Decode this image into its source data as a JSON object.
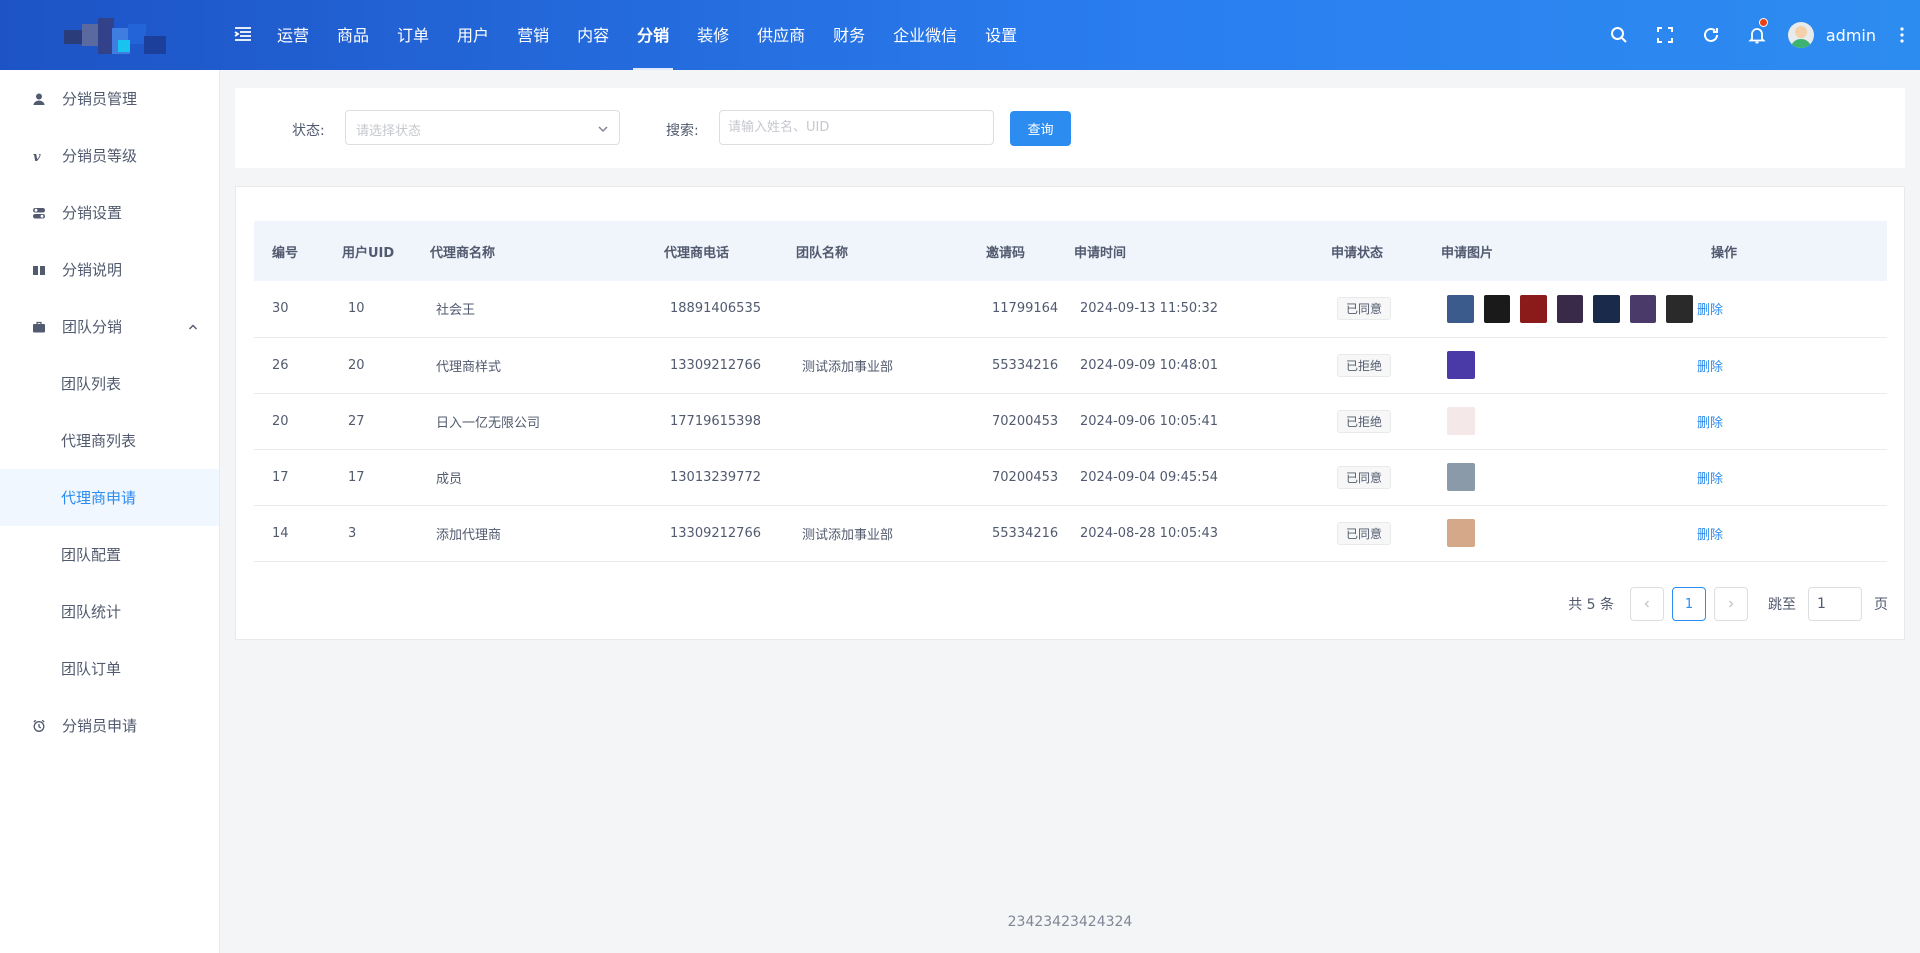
{
  "header": {
    "nav": [
      "运营",
      "商品",
      "订单",
      "用户",
      "营销",
      "内容",
      "分销",
      "装修",
      "供应商",
      "财务",
      "企业微信",
      "设置"
    ],
    "active_nav": "分销",
    "username": "admin"
  },
  "sidebar": {
    "items": [
      {
        "label": "分销员管理",
        "icon": "user-icon"
      },
      {
        "label": "分销员等级",
        "icon": "vimeo-icon"
      },
      {
        "label": "分销设置",
        "icon": "toggle-icon"
      },
      {
        "label": "分销说明",
        "icon": "book-icon"
      },
      {
        "label": "团队分销",
        "icon": "briefcase-icon"
      },
      {
        "label": "团队列表"
      },
      {
        "label": "代理商列表"
      },
      {
        "label": "代理商申请"
      },
      {
        "label": "团队配置"
      },
      {
        "label": "团队统计"
      },
      {
        "label": "团队订单"
      },
      {
        "label": "分销员申请",
        "icon": "alarm-clock-icon"
      }
    ],
    "active": "代理商申请"
  },
  "filter": {
    "status_label": "状态:",
    "status_placeholder": "请选择状态",
    "search_label": "搜索:",
    "search_placeholder": "请输入姓名、UID",
    "query_button": "查询"
  },
  "table": {
    "columns": [
      "编号",
      "用户UID",
      "代理商名称",
      "代理商电话",
      "团队名称",
      "邀请码",
      "申请时间",
      "申请状态",
      "申请图片",
      "操作"
    ],
    "rows": [
      {
        "id": "30",
        "uid": "10",
        "name": "社会王",
        "phone": "18891406535",
        "team": "",
        "code": "11799164",
        "time": "2024-09-13 11:50:32",
        "status": "已同意",
        "images": [
          "#3b5b8c",
          "#1a1a1a",
          "#8b1a1a",
          "#3a2a4a",
          "#1a2a4a",
          "#4a3a6a",
          "#2a2a2a"
        ],
        "action": "删除"
      },
      {
        "id": "26",
        "uid": "20",
        "name": "代理商样式",
        "phone": "13309212766",
        "team": "测试添加事业部",
        "code": "55334216",
        "time": "2024-09-09 10:48:01",
        "status": "已拒绝",
        "images": [
          "#4a3aa8"
        ],
        "action": "删除"
      },
      {
        "id": "20",
        "uid": "27",
        "name": "日入一亿无限公司",
        "phone": "17719615398",
        "team": "",
        "code": "70200453",
        "time": "2024-09-06 10:05:41",
        "status": "已拒绝",
        "images": [
          "#f4e8e8"
        ],
        "action": "删除"
      },
      {
        "id": "17",
        "uid": "17",
        "name": "成员",
        "phone": "13013239772",
        "team": "",
        "code": "70200453",
        "time": "2024-09-04 09:45:54",
        "status": "已同意",
        "images": [
          "#8a9aa8"
        ],
        "action": "删除"
      },
      {
        "id": "14",
        "uid": "3",
        "name": "添加代理商",
        "phone": "13309212766",
        "team": "测试添加事业部",
        "code": "55334216",
        "time": "2024-08-28 10:05:43",
        "status": "已同意",
        "images": [
          "#d4a888"
        ],
        "action": "删除"
      }
    ]
  },
  "pagination": {
    "total_text": "共 5 条",
    "current_page": "1",
    "goto_label": "跳至",
    "goto_value": "1",
    "page_suffix": "页"
  },
  "footer": "23423423424324"
}
